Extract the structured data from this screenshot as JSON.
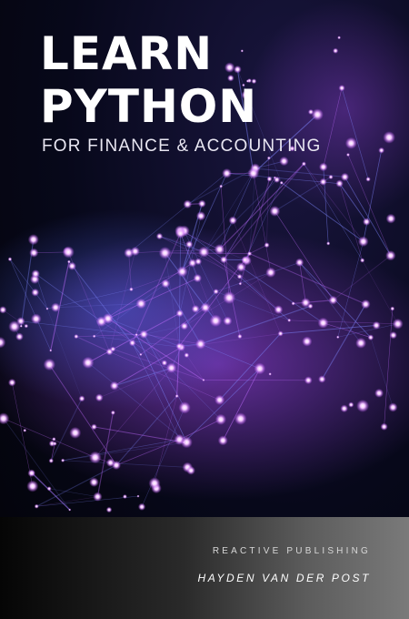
{
  "cover": {
    "title_line1": "LEARN",
    "title_line2": "PYTHON",
    "subtitle": "FOR FINANCE & ACCOUNTING",
    "publisher": "REACTIVE PUBLISHING",
    "author": "HAYDEN VAN DER POST"
  },
  "colors": {
    "background": "#07081a",
    "glow_violet": "#b04dff",
    "glow_blue": "#5b6cff",
    "footer_dark": "#050505",
    "footer_light": "#7a7a7a",
    "title_text": "#ffffff"
  }
}
